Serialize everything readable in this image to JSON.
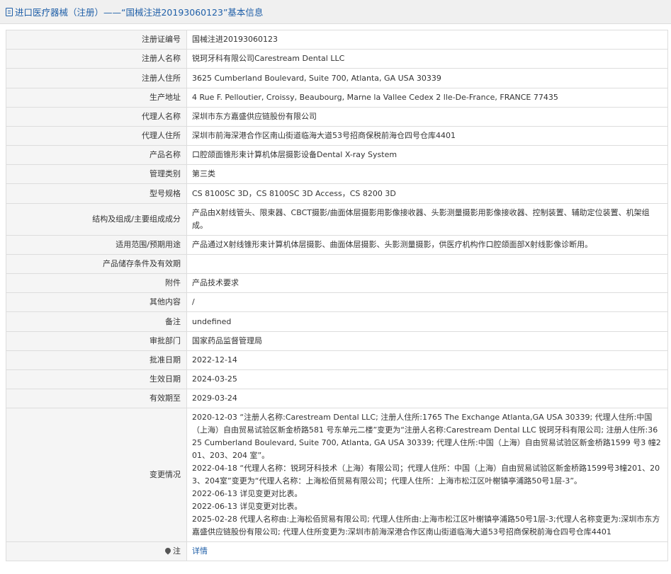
{
  "header": {
    "title": "进口医疗器械（注册）——“国械注进20193060123”基本信息"
  },
  "rows": [
    {
      "label": "注册证编号",
      "value": "国械注进20193060123"
    },
    {
      "label": "注册人名称",
      "value": "锐珂牙科有限公司Carestream Dental LLC"
    },
    {
      "label": "注册人住所",
      "value": "3625 Cumberland Boulevard, Suite 700, Atlanta, GA USA 30339"
    },
    {
      "label": "生产地址",
      "value": "4 Rue F. Pelloutier, Croissy, Beaubourg, Marne la Vallee Cedex 2 lle-De-France, FRANCE 77435"
    },
    {
      "label": "代理人名称",
      "value": "深圳市东方嘉盛供应链股份有限公司"
    },
    {
      "label": "代理人住所",
      "value": "深圳市前海深港合作区南山街道临海大道53号招商保税前海仓四号仓库4401"
    },
    {
      "label": "产品名称",
      "value": "口腔颌面锥形束计算机体层摄影设备Dental X-ray System"
    },
    {
      "label": "管理类别",
      "value": "第三类"
    },
    {
      "label": "型号规格",
      "value": "CS 8100SC 3D，CS 8100SC 3D Access，CS 8200 3D"
    },
    {
      "label": "结构及组成/主要组成成分",
      "value": "产品由X射线管头、限束器、CBCT摄影/曲面体层摄影用影像接收器、头影测量摄影用影像接收器、控制装置、辅助定位装置、机架组成。"
    },
    {
      "label": "适用范围/预期用途",
      "value": "产品通过X射线锥形束计算机体层摄影、曲面体层摄影、头影测量摄影，供医疗机构作口腔颌面部X射线影像诊断用。"
    },
    {
      "label": "产品储存条件及有效期",
      "value": ""
    },
    {
      "label": "附件",
      "value": "产品技术要求"
    },
    {
      "label": "其他内容",
      "value": "/"
    },
    {
      "label": "备注",
      "value": "undefined"
    },
    {
      "label": "审批部门",
      "value": "国家药品监督管理局"
    },
    {
      "label": "批准日期",
      "value": "2022-12-14"
    },
    {
      "label": "生效日期",
      "value": "2024-03-25"
    },
    {
      "label": "有效期至",
      "value": "2029-03-24"
    }
  ],
  "changes": {
    "label": "变更情况",
    "entries": [
      "2020-12-03 “注册人名称:Carestream Dental LLC; 注册人住所:1765 The Exchange Atlanta,GA USA 30339; 代理人住所:中国（上海）自由贸易试验区新金桥路581 号东单元二楼”变更为“注册人名称:Carestream Dental LLC 锐珂牙科有限公司; 注册人住所:3625 Cumberland Boulevard, Suite 700, Atlanta, GA USA 30339; 代理人住所:中国（上海）自由贸易试验区新金桥路1599 号3 幢201、203、204 室”。",
      "2022-04-18 “代理人名称：锐珂牙科技术（上海）有限公司；代理人住所：中国（上海）自由贸易试验区新金桥路1599号3幢201、203、204室”变更为“代理人名称：上海松佰贸易有限公司；代理人住所：上海市松江区叶榭镇亭浦路50号1层-3”。",
      "2022-06-13 详见变更对比表。",
      "2022-06-13 详见变更对比表。",
      "2025-02-28 代理人名称由:上海松佰贸易有限公司; 代理人住所由:上海市松江区叶榭镇亭浦路50号1层-3;代理人名称变更为:深圳市东方嘉盛供应链股份有限公司; 代理人住所变更为:深圳市前海深港合作区南山街道临海大道53号招商保税前海仓四号仓库4401"
    ]
  },
  "note": {
    "label": "注",
    "icon": "pin-icon",
    "link_text": "详情"
  },
  "colors": {
    "link": "#1f5fa8",
    "label_bg": "#f5f5f5",
    "border": "#dddddd"
  }
}
